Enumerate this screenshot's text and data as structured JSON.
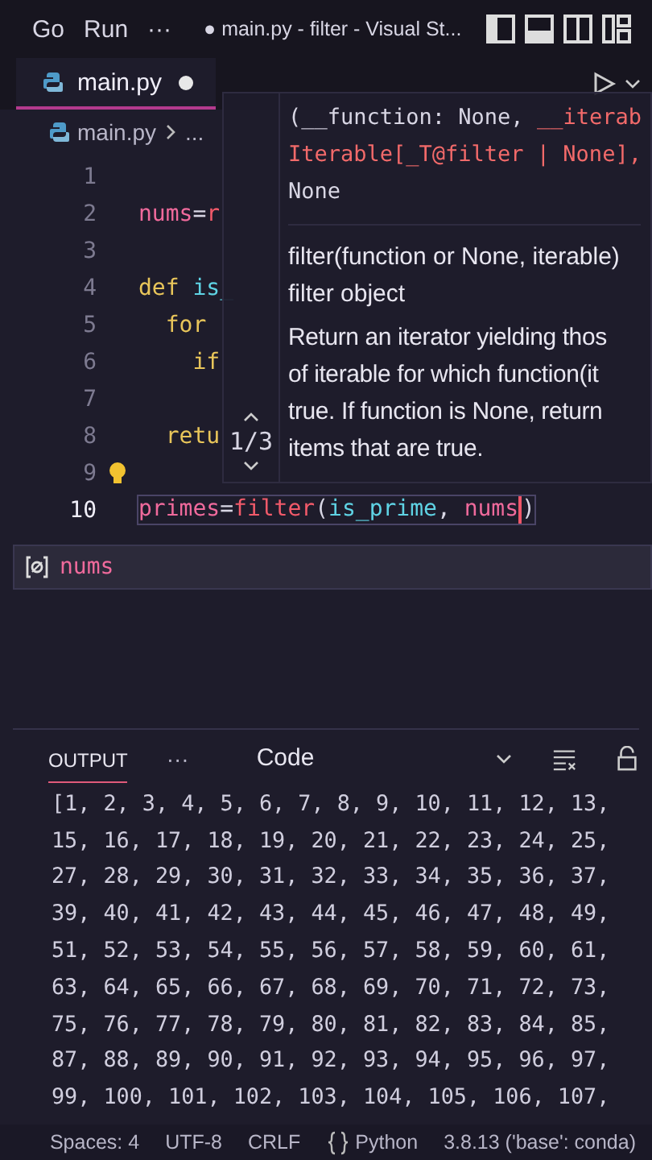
{
  "menu_bar": {
    "items": [
      "Go",
      "Run",
      "···"
    ],
    "title": "● main.py - filter - Visual St..."
  },
  "tabs": [
    {
      "label": "main.py",
      "modified": true,
      "selected": true
    }
  ],
  "breadcrumb": [
    "main.py",
    "..."
  ],
  "code_lines": [
    {
      "number": "1",
      "current": false,
      "lightbulb": false
    },
    {
      "number": "2",
      "current": false,
      "lightbulb": false,
      "tokens": [
        {
          "text": "nums",
          "kind": "variable"
        },
        {
          "text": "=",
          "kind": "plain"
        },
        {
          "text": "r",
          "kind": "builtin"
        }
      ]
    },
    {
      "number": "3",
      "current": false,
      "lightbulb": false
    },
    {
      "number": "4",
      "current": false,
      "lightbulb": false,
      "tokens": [
        {
          "text": "def ",
          "kind": "keyword"
        },
        {
          "text": "is_",
          "kind": "function"
        }
      ]
    },
    {
      "number": "5",
      "current": false,
      "lightbulb": false,
      "tokens": [
        {
          "text": "  for",
          "kind": "keyword"
        }
      ]
    },
    {
      "number": "6",
      "current": false,
      "lightbulb": false,
      "tokens": [
        {
          "text": "    if",
          "kind": "keyword"
        }
      ]
    },
    {
      "number": "7",
      "current": false,
      "lightbulb": false
    },
    {
      "number": "8",
      "current": false,
      "lightbulb": false,
      "tokens": [
        {
          "text": "  retu",
          "kind": "keyword"
        }
      ]
    },
    {
      "number": "9",
      "current": false,
      "lightbulb": true
    },
    {
      "number": "10",
      "current": true,
      "lightbulb": false,
      "tokens": [
        {
          "text": "primes",
          "kind": "variable"
        },
        {
          "text": "=",
          "kind": "plain"
        },
        {
          "text": "filter",
          "kind": "builtin"
        },
        {
          "text": "(",
          "kind": "bracket"
        },
        {
          "text": "is_prime",
          "kind": "function"
        },
        {
          "text": ", ",
          "kind": "plain"
        },
        {
          "text": "nums",
          "kind": "variable"
        },
        {
          "text": ")",
          "kind": "bracket"
        }
      ]
    }
  ],
  "hover": {
    "overload": "1/3",
    "signature": [
      [
        {
          "text": "(__function: None, ",
          "kind": "plain"
        },
        {
          "text": "__iterab",
          "kind": "active"
        }
      ],
      [
        {
          "text": "Iterable[_T@filter | None],",
          "kind": "active"
        }
      ],
      [
        {
          "text": "None",
          "kind": "plain"
        }
      ]
    ],
    "doc": [
      "filter(function or None, iterable)",
      "filter object"
    ],
    "description": [
      "Return an iterator yielding thos",
      "of iterable for which function(it",
      "true. If function is None, return",
      "items that are true."
    ]
  },
  "suggestion": {
    "label": "nums",
    "selected": true
  },
  "panel": {
    "tabs": [
      {
        "label": "OUTPUT",
        "selected": true
      }
    ],
    "more": "···",
    "channel": "Code",
    "lines": [
      "[1, 2, 3, 4, 5, 6, 7, 8, 9, 10, 11, 12, 13,",
      "15, 16, 17, 18, 19, 20, 21, 22, 23, 24, 25,",
      "27, 28, 29, 30, 31, 32, 33, 34, 35, 36, 37,",
      "39, 40, 41, 42, 43, 44, 45, 46, 47, 48, 49,",
      "51, 52, 53, 54, 55, 56, 57, 58, 59, 60, 61,",
      "63, 64, 65, 66, 67, 68, 69, 70, 71, 72, 73,",
      "75, 76, 77, 78, 79, 80, 81, 82, 83, 84, 85,",
      "87, 88, 89, 90, 91, 92, 93, 94, 95, 96, 97,",
      "99, 100, 101, 102, 103, 104, 105, 106, 107,"
    ]
  },
  "status_bar": {
    "items": [
      "Spaces: 4",
      "UTF-8",
      "CRLF",
      "Python",
      "3.8.13 ('base': conda)"
    ]
  }
}
